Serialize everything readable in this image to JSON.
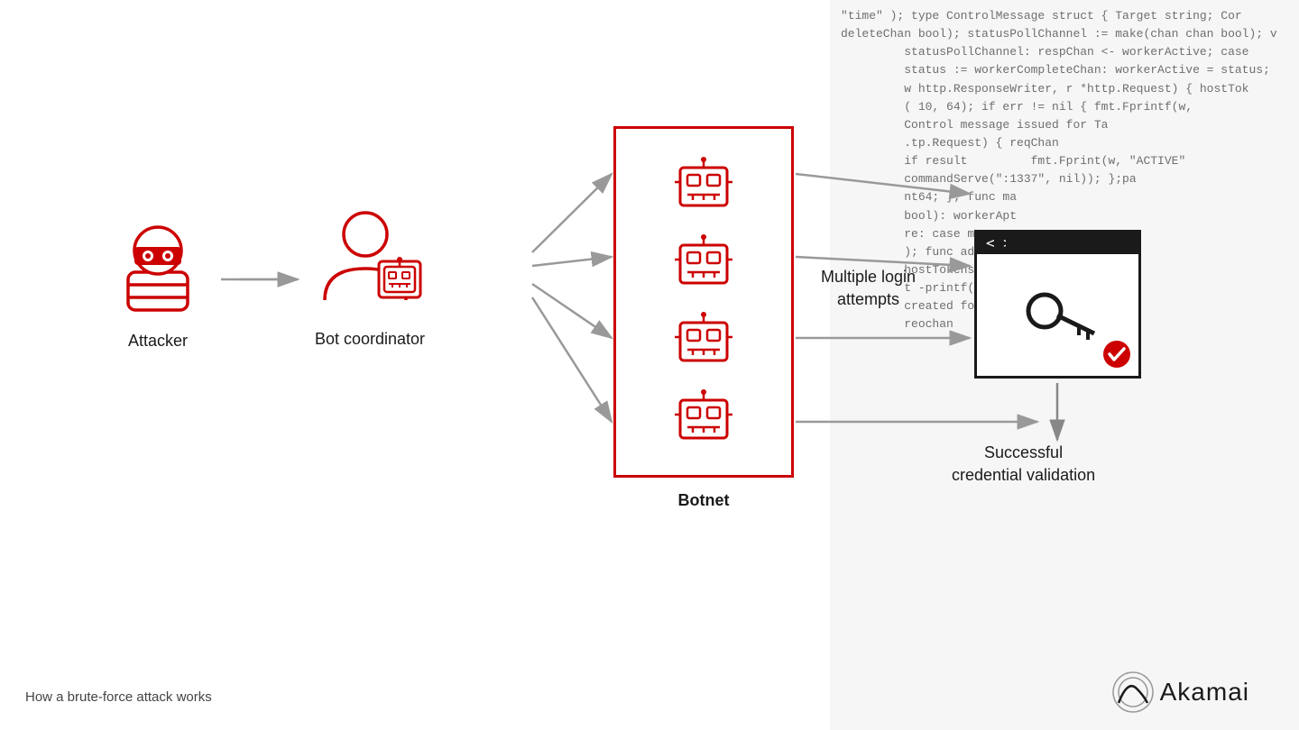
{
  "code_lines": [
    "\"time\" ); type ControlMessage struct { Target string; Cor",
    "deleteChan bool); statusPollChannel := make(chan chan bool); v",
    "         statusPollChannel: respChan <- workerActive; case",
    "         status := workerCompleteChan: workerActive = status;",
    "         w http.ResponseWriter, r *http.Request) { hostTok",
    "         ( 10, 64); if err != nil { fmt.Fprintf(w,",
    "         Control message issued for Ta",
    "         .tp.Request) { reqChan",
    "         if result         fmt.Fprint(w, \"ACTIVE\"",
    "         commandServe(\":1337\", nil)); };pa",
    "         nt64; }; func ma",
    "         bool): workerApt",
    "         re: case msg :=s",
    "         ); func admin(t",
    "         hostTokens",
    "         t -printf(w,",
    "         created for ta",
    "         reochan",
    ""
  ],
  "labels": {
    "attacker": "Attacker",
    "bot_coordinator": "Bot coordinator",
    "botnet": "Botnet",
    "login_attempts_line1": "Multiple login",
    "login_attempts_line2": "attempts",
    "success_line1": "Successful",
    "success_line2": "credential validation",
    "footer": "How a brute-force attack works",
    "brand": "Akamai"
  },
  "colors": {
    "red": "#cc0000",
    "dark": "#1a1a1a",
    "gray_arrow": "#999999",
    "down_arrow": "#888888"
  }
}
